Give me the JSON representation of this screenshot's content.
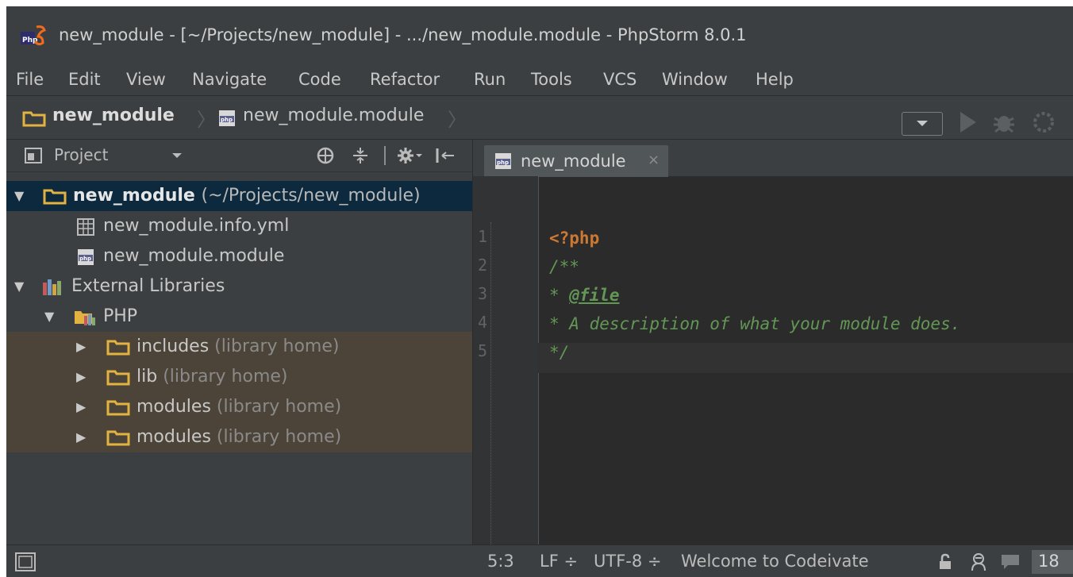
{
  "window": {
    "title": "new_module - [~/Projects/new_module] - .../new_module.module - PhpStorm 8.0.1"
  },
  "menu": [
    "File",
    "Edit",
    "View",
    "Navigate",
    "Code",
    "Refactor",
    "Run",
    "Tools",
    "VCS",
    "Window",
    "Help"
  ],
  "navbar": {
    "project": "new_module",
    "file": "new_module.module"
  },
  "project_panel": {
    "title": "Project",
    "root": {
      "label": "new_module",
      "path": "(~/Projects/new_module)"
    },
    "files": [
      "new_module.info.yml",
      "new_module.module"
    ],
    "external": "External Libraries",
    "php": "PHP",
    "libraries": [
      {
        "label": "includes",
        "hint": "(library home)"
      },
      {
        "label": "lib",
        "hint": "(library home)"
      },
      {
        "label": "modules",
        "hint": "(library home)"
      },
      {
        "label": "modules",
        "hint": "(library home)"
      }
    ]
  },
  "editor": {
    "tab": "new_module",
    "tab_close": "×",
    "line_numbers": [
      "1",
      "2",
      "3",
      "4",
      "5"
    ],
    "code": {
      "l1": "<?php",
      "l2": "/**",
      "l3_prefix": "* ",
      "l3_tag": "@file",
      "l4": "* A description of what your module does.",
      "l5": "*/"
    }
  },
  "status": {
    "position": "5:3",
    "line_sep": "LF ÷",
    "encoding": "UTF-8 ÷",
    "message": "Welcome to Codeivate",
    "badge": "18"
  },
  "colors": {
    "keyword": "#cc7832",
    "comment": "#629755",
    "folder": "#e3b341",
    "selection": "#0d293e"
  },
  "icons": [
    "phpstorm-logo-icon",
    "folder-icon",
    "php-file-icon",
    "project-view-icon",
    "dropdown-arrow-icon",
    "locate-icon",
    "collapse-icon",
    "settings-icon",
    "hide-icon",
    "yml-file-icon",
    "library-icon",
    "php-library-icon",
    "run-icon",
    "debug-icon",
    "coverage-icon",
    "toggle-panels-icon",
    "lock-icon",
    "inspector-icon",
    "chat-icon"
  ]
}
